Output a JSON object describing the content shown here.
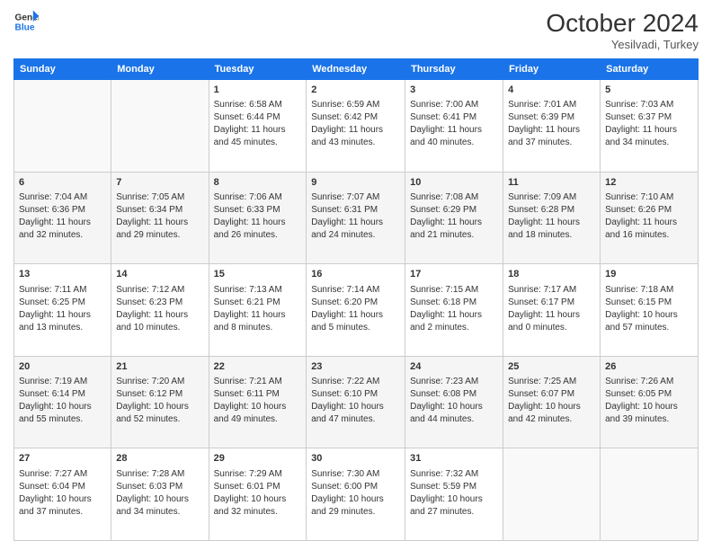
{
  "header": {
    "logo_line1": "General",
    "logo_line2": "Blue",
    "month": "October 2024",
    "location": "Yesilvadi, Turkey"
  },
  "days_of_week": [
    "Sunday",
    "Monday",
    "Tuesday",
    "Wednesday",
    "Thursday",
    "Friday",
    "Saturday"
  ],
  "weeks": [
    [
      {
        "day": "",
        "content": ""
      },
      {
        "day": "",
        "content": ""
      },
      {
        "day": "1",
        "content": "Sunrise: 6:58 AM\nSunset: 6:44 PM\nDaylight: 11 hours and 45 minutes."
      },
      {
        "day": "2",
        "content": "Sunrise: 6:59 AM\nSunset: 6:42 PM\nDaylight: 11 hours and 43 minutes."
      },
      {
        "day": "3",
        "content": "Sunrise: 7:00 AM\nSunset: 6:41 PM\nDaylight: 11 hours and 40 minutes."
      },
      {
        "day": "4",
        "content": "Sunrise: 7:01 AM\nSunset: 6:39 PM\nDaylight: 11 hours and 37 minutes."
      },
      {
        "day": "5",
        "content": "Sunrise: 7:03 AM\nSunset: 6:37 PM\nDaylight: 11 hours and 34 minutes."
      }
    ],
    [
      {
        "day": "6",
        "content": "Sunrise: 7:04 AM\nSunset: 6:36 PM\nDaylight: 11 hours and 32 minutes."
      },
      {
        "day": "7",
        "content": "Sunrise: 7:05 AM\nSunset: 6:34 PM\nDaylight: 11 hours and 29 minutes."
      },
      {
        "day": "8",
        "content": "Sunrise: 7:06 AM\nSunset: 6:33 PM\nDaylight: 11 hours and 26 minutes."
      },
      {
        "day": "9",
        "content": "Sunrise: 7:07 AM\nSunset: 6:31 PM\nDaylight: 11 hours and 24 minutes."
      },
      {
        "day": "10",
        "content": "Sunrise: 7:08 AM\nSunset: 6:29 PM\nDaylight: 11 hours and 21 minutes."
      },
      {
        "day": "11",
        "content": "Sunrise: 7:09 AM\nSunset: 6:28 PM\nDaylight: 11 hours and 18 minutes."
      },
      {
        "day": "12",
        "content": "Sunrise: 7:10 AM\nSunset: 6:26 PM\nDaylight: 11 hours and 16 minutes."
      }
    ],
    [
      {
        "day": "13",
        "content": "Sunrise: 7:11 AM\nSunset: 6:25 PM\nDaylight: 11 hours and 13 minutes."
      },
      {
        "day": "14",
        "content": "Sunrise: 7:12 AM\nSunset: 6:23 PM\nDaylight: 11 hours and 10 minutes."
      },
      {
        "day": "15",
        "content": "Sunrise: 7:13 AM\nSunset: 6:21 PM\nDaylight: 11 hours and 8 minutes."
      },
      {
        "day": "16",
        "content": "Sunrise: 7:14 AM\nSunset: 6:20 PM\nDaylight: 11 hours and 5 minutes."
      },
      {
        "day": "17",
        "content": "Sunrise: 7:15 AM\nSunset: 6:18 PM\nDaylight: 11 hours and 2 minutes."
      },
      {
        "day": "18",
        "content": "Sunrise: 7:17 AM\nSunset: 6:17 PM\nDaylight: 11 hours and 0 minutes."
      },
      {
        "day": "19",
        "content": "Sunrise: 7:18 AM\nSunset: 6:15 PM\nDaylight: 10 hours and 57 minutes."
      }
    ],
    [
      {
        "day": "20",
        "content": "Sunrise: 7:19 AM\nSunset: 6:14 PM\nDaylight: 10 hours and 55 minutes."
      },
      {
        "day": "21",
        "content": "Sunrise: 7:20 AM\nSunset: 6:12 PM\nDaylight: 10 hours and 52 minutes."
      },
      {
        "day": "22",
        "content": "Sunrise: 7:21 AM\nSunset: 6:11 PM\nDaylight: 10 hours and 49 minutes."
      },
      {
        "day": "23",
        "content": "Sunrise: 7:22 AM\nSunset: 6:10 PM\nDaylight: 10 hours and 47 minutes."
      },
      {
        "day": "24",
        "content": "Sunrise: 7:23 AM\nSunset: 6:08 PM\nDaylight: 10 hours and 44 minutes."
      },
      {
        "day": "25",
        "content": "Sunrise: 7:25 AM\nSunset: 6:07 PM\nDaylight: 10 hours and 42 minutes."
      },
      {
        "day": "26",
        "content": "Sunrise: 7:26 AM\nSunset: 6:05 PM\nDaylight: 10 hours and 39 minutes."
      }
    ],
    [
      {
        "day": "27",
        "content": "Sunrise: 7:27 AM\nSunset: 6:04 PM\nDaylight: 10 hours and 37 minutes."
      },
      {
        "day": "28",
        "content": "Sunrise: 7:28 AM\nSunset: 6:03 PM\nDaylight: 10 hours and 34 minutes."
      },
      {
        "day": "29",
        "content": "Sunrise: 7:29 AM\nSunset: 6:01 PM\nDaylight: 10 hours and 32 minutes."
      },
      {
        "day": "30",
        "content": "Sunrise: 7:30 AM\nSunset: 6:00 PM\nDaylight: 10 hours and 29 minutes."
      },
      {
        "day": "31",
        "content": "Sunrise: 7:32 AM\nSunset: 5:59 PM\nDaylight: 10 hours and 27 minutes."
      },
      {
        "day": "",
        "content": ""
      },
      {
        "day": "",
        "content": ""
      }
    ]
  ]
}
